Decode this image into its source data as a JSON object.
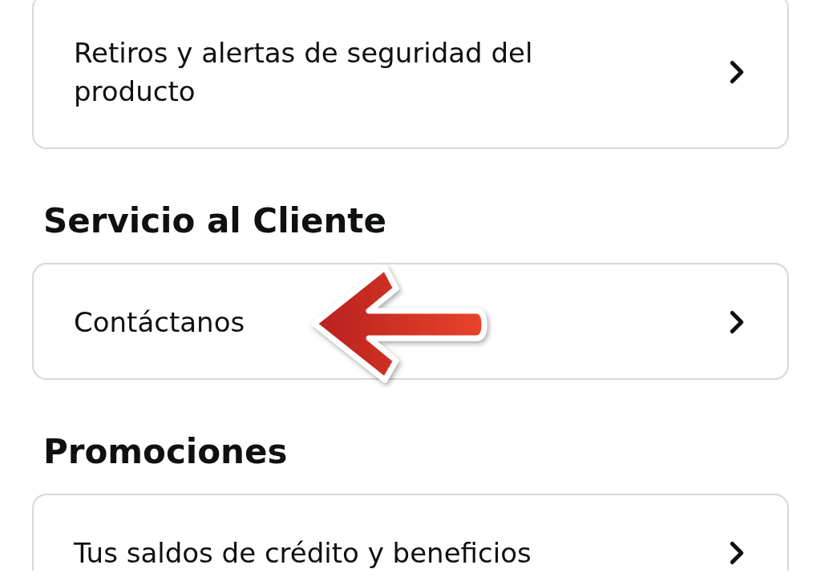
{
  "sections": [
    {
      "items": [
        {
          "label": "Retiros y alertas de seguridad del producto",
          "marked": false
        }
      ]
    },
    {
      "heading": "Servicio al Cliente",
      "items": [
        {
          "label": "Contáctanos",
          "marked": true
        }
      ]
    },
    {
      "heading": "Promociones",
      "items": [
        {
          "label": "Tus saldos de crédito y beneficios",
          "marked": false
        }
      ]
    }
  ]
}
